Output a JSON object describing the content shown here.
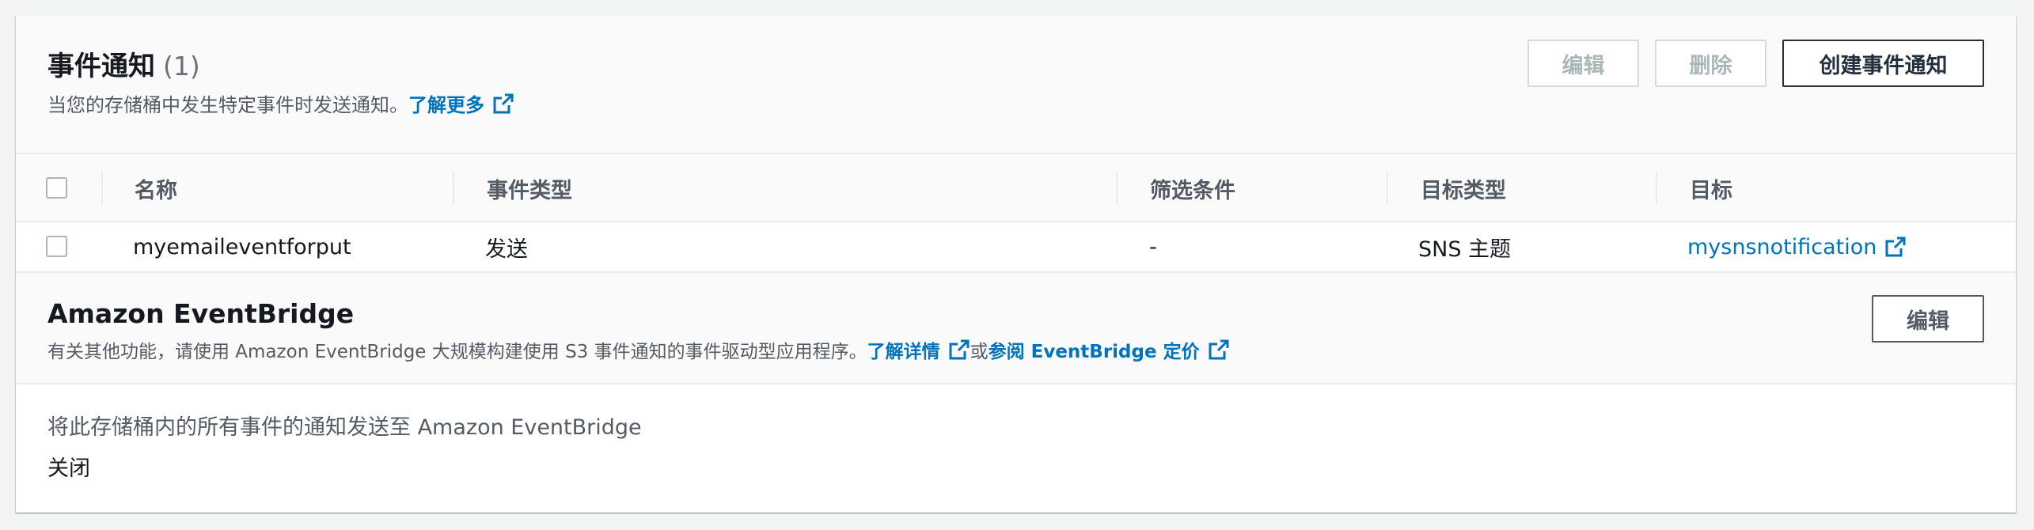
{
  "event_notifications": {
    "title": "事件通知",
    "count": "(1)",
    "description": "当您的存储桶中发生特定事件时发送通知。",
    "learn_more": "了解更多",
    "buttons": {
      "edit": "编辑",
      "delete": "删除",
      "create": "创建事件通知"
    },
    "table": {
      "columns": [
        "名称",
        "事件类型",
        "筛选条件",
        "目标类型",
        "目标"
      ],
      "rows": [
        {
          "name": "myemaileventforput",
          "event_type": "发送",
          "filter": "-",
          "destination_type": "SNS 主题",
          "destination": "mysnsnotification"
        }
      ]
    }
  },
  "eventbridge": {
    "title": "Amazon EventBridge",
    "description": "有关其他功能，请使用 Amazon EventBridge 大规模构建使用 S3 事件通知的事件驱动型应用程序。",
    "learn_details": "了解详情",
    "or_text": "或",
    "pricing_link": "参阅 EventBridge 定价",
    "edit_button": "编辑",
    "setting_label": "将此存储桶内的所有事件的通知发送至 Amazon EventBridge",
    "setting_value": "关闭"
  },
  "colors": {
    "link": "#0073bb",
    "primary_text": "#16191f",
    "secondary_text": "#545b64",
    "disabled": "#aab7b8"
  },
  "icons": {
    "external_link": "external-link-icon",
    "checkbox": "checkbox"
  }
}
